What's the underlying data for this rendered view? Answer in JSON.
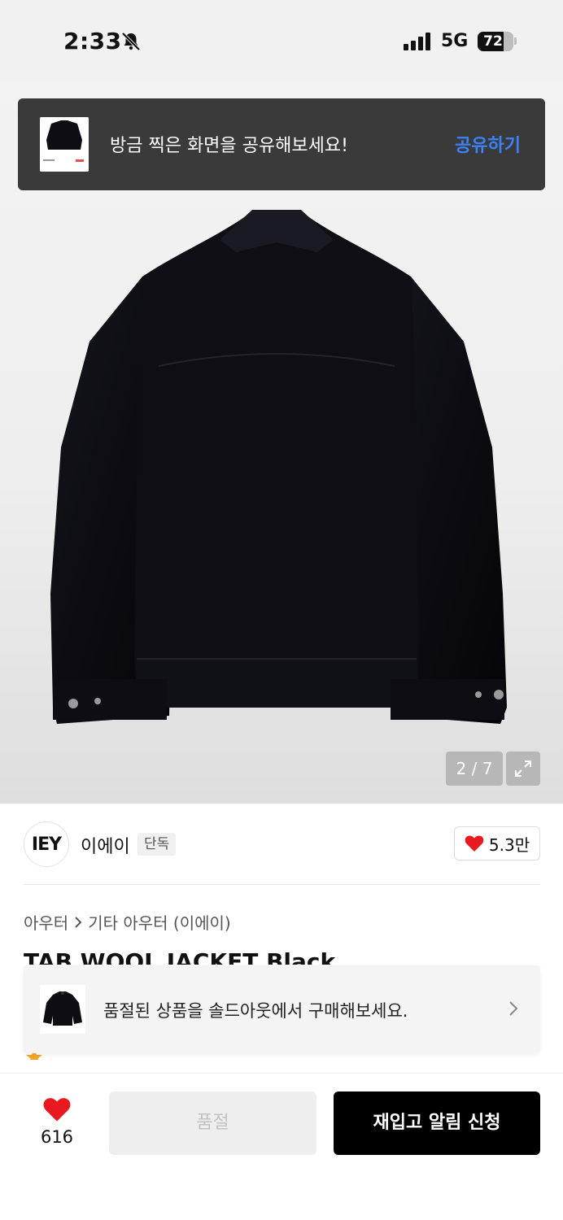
{
  "status_bar": {
    "time": "2:33",
    "network": "5G",
    "battery": "72",
    "battery_level": 0.72
  },
  "share_toast": {
    "message": "방금 찍은 화면을 공유해보세요!",
    "action": "공유하기"
  },
  "gallery": {
    "counter": "2 / 7",
    "current": 2,
    "total": 7
  },
  "brand": {
    "logo_text": "IEY",
    "name": "이에이",
    "badge": "단독",
    "like_count": "5.3만"
  },
  "breadcrumb": {
    "category": "아우터",
    "subcategory": "기타 아우터 (이에이)"
  },
  "product": {
    "title": "TAB WOOL JACKET Black"
  },
  "soldout_banner": {
    "message": "품절된 상품을 솔드아웃에서 구매해보세요."
  },
  "bottom_bar": {
    "wish_count": "616",
    "soldout_label": "품절",
    "restock_label": "재입고 알림 신청"
  },
  "colors": {
    "accent_blue": "#3b82f6",
    "heart_red": "#e8191f",
    "primary_black": "#000000"
  }
}
